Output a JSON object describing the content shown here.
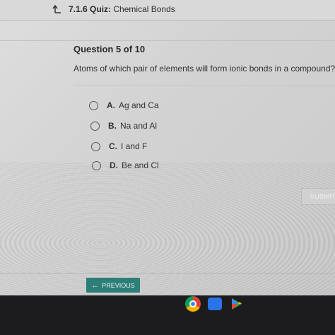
{
  "header": {
    "back_icon": "return-arrow-icon",
    "quiz_number": "7.1.6",
    "quiz_label": "Quiz:",
    "quiz_name": "Chemical Bonds"
  },
  "question": {
    "number_label": "Question 5 of 10",
    "text": "Atoms of which pair of elements will form ionic bonds in a compound?"
  },
  "options": [
    {
      "letter": "A.",
      "text": "Ag and Ca",
      "selected": false
    },
    {
      "letter": "B.",
      "text": "Na and Al",
      "selected": false
    },
    {
      "letter": "C.",
      "text": "I and F",
      "selected": false
    },
    {
      "letter": "D.",
      "text": "Be and Cl",
      "selected": false
    }
  ],
  "actions": {
    "submit_label": "SUBMIT",
    "previous_label": "PREVIOUS",
    "previous_icon": "left-arrow-icon"
  },
  "shelf": {
    "apps": [
      "chrome-icon",
      "files-icon",
      "play-store-icon"
    ]
  },
  "colors": {
    "previous_button": "#2d7d78",
    "submit_disabled": "#d0d0d0"
  }
}
